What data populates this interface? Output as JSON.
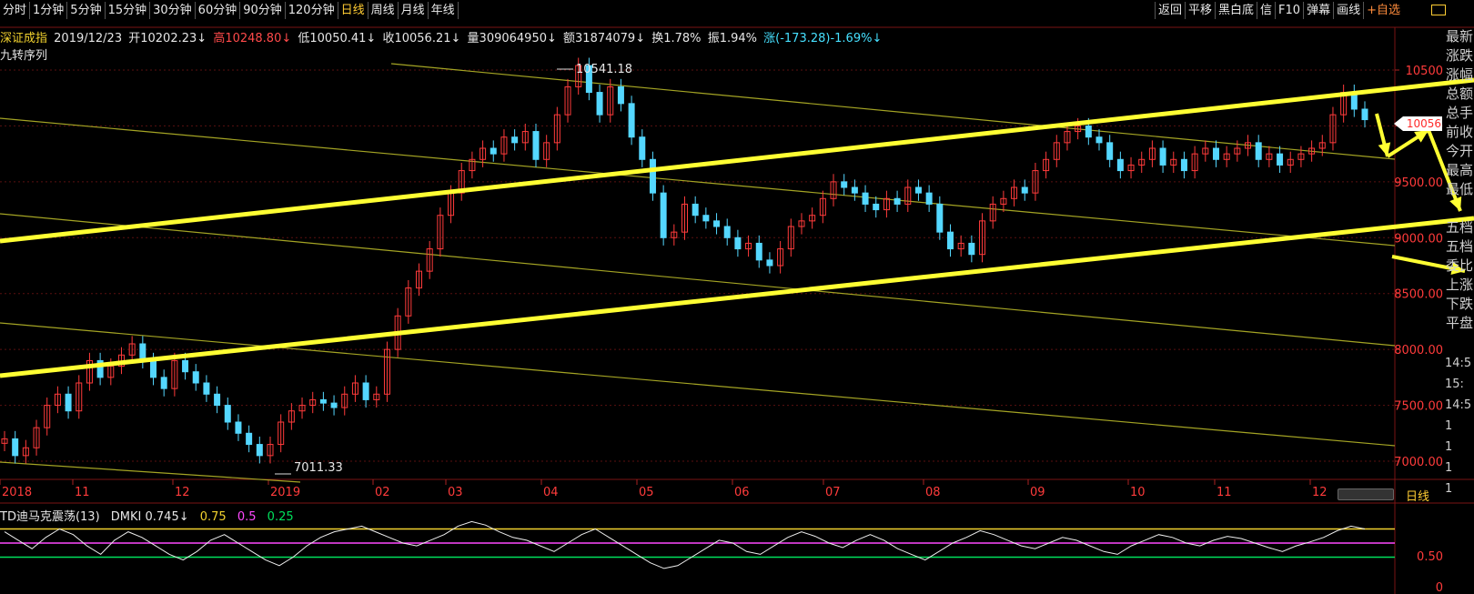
{
  "toolbar": {
    "periods": [
      {
        "label": "分时",
        "active": false
      },
      {
        "label": "1分钟",
        "active": false
      },
      {
        "label": "5分钟",
        "active": false
      },
      {
        "label": "15分钟",
        "active": false
      },
      {
        "label": "30分钟",
        "active": false
      },
      {
        "label": "60分钟",
        "active": false
      },
      {
        "label": "90分钟",
        "active": false
      },
      {
        "label": "120分钟",
        "active": false
      },
      {
        "label": "日线",
        "active": true
      },
      {
        "label": "周线",
        "active": false
      },
      {
        "label": "月线",
        "active": false
      },
      {
        "label": "年线",
        "active": false
      }
    ],
    "actions": [
      {
        "label": "返回"
      },
      {
        "label": "平移"
      },
      {
        "label": "黑白底"
      },
      {
        "label": "信"
      },
      {
        "label": "F10"
      },
      {
        "label": "弹幕"
      },
      {
        "label": "画线"
      },
      {
        "label": "+自选",
        "accent": true
      }
    ]
  },
  "info": {
    "name": "深证成指",
    "date": "2019/12/23",
    "open": "开10202.23↓",
    "high": "高10248.80↓",
    "low": "低10050.41↓",
    "close": "收10056.21↓",
    "volume": "量309064950↓",
    "amount": "额31874079↓",
    "turnover": "换1.78%",
    "amplitude": "振1.94%",
    "change": "涨(-173.28)-1.69%↓"
  },
  "subtitle": "九转序列",
  "indicator": {
    "name": "TD迪马克震荡(13)",
    "dmki": "DMKI 0.745↓",
    "v1": "0.75",
    "v2": "0.5",
    "v3": "0.25"
  },
  "chart_data": {
    "type": "candlestick",
    "y_axis_ticks": [
      "10500",
      "10000",
      "9500.00",
      "9000.00",
      "8500.00",
      "8000.00",
      "7500.00",
      "7000.00"
    ],
    "x_axis_labels": [
      "2018",
      "11",
      "12",
      "2019",
      "02",
      "03",
      "04",
      "05",
      "06",
      "07",
      "08",
      "09",
      "10",
      "11",
      "12"
    ],
    "current_price_label": "10056",
    "peak_label": "10541.18",
    "trough_label": "7011.33",
    "indicator_axis_ticks": [
      "0.50",
      "0"
    ],
    "closes": [
      7200,
      7050,
      7120,
      7300,
      7500,
      7600,
      7450,
      7700,
      7900,
      7750,
      7850,
      7950,
      8050,
      7900,
      7750,
      7650,
      7900,
      7800,
      7700,
      7600,
      7500,
      7350,
      7250,
      7150,
      7050,
      7150,
      7350,
      7450,
      7500,
      7550,
      7520,
      7480,
      7600,
      7700,
      7550,
      7600,
      8000,
      8300,
      8550,
      8700,
      8900,
      9200,
      9400,
      9600,
      9700,
      9800,
      9750,
      9900,
      9850,
      9950,
      9700,
      9850,
      10100,
      10350,
      10540,
      10300,
      10100,
      10350,
      10200,
      9900,
      9700,
      9400,
      9000,
      9050,
      9300,
      9200,
      9150,
      9100,
      9000,
      8900,
      8950,
      8800,
      8750,
      8900,
      9100,
      9150,
      9200,
      9350,
      9500,
      9450,
      9400,
      9300,
      9250,
      9350,
      9300,
      9450,
      9400,
      9300,
      9050,
      8900,
      8950,
      8850,
      9150,
      9300,
      9350,
      9450,
      9400,
      9600,
      9700,
      9850,
      9950,
      10000,
      9900,
      9850,
      9700,
      9600,
      9650,
      9700,
      9800,
      9650,
      9700,
      9600,
      9750,
      9800,
      9700,
      9750,
      9800,
      9850,
      9700,
      9750,
      9650,
      9700,
      9750,
      9800,
      9850,
      10100,
      10300,
      10150,
      10056
    ],
    "indicator_values": [
      0.7,
      0.55,
      0.4,
      0.6,
      0.75,
      0.65,
      0.45,
      0.3,
      0.55,
      0.7,
      0.6,
      0.45,
      0.3,
      0.2,
      0.35,
      0.55,
      0.65,
      0.5,
      0.35,
      0.2,
      0.1,
      0.25,
      0.45,
      0.6,
      0.7,
      0.75,
      0.8,
      0.7,
      0.6,
      0.5,
      0.45,
      0.55,
      0.65,
      0.8,
      0.88,
      0.82,
      0.7,
      0.6,
      0.55,
      0.45,
      0.35,
      0.5,
      0.65,
      0.75,
      0.6,
      0.45,
      0.3,
      0.15,
      0.05,
      0.1,
      0.25,
      0.4,
      0.55,
      0.5,
      0.35,
      0.3,
      0.45,
      0.6,
      0.7,
      0.62,
      0.5,
      0.42,
      0.55,
      0.65,
      0.55,
      0.4,
      0.3,
      0.2,
      0.35,
      0.5,
      0.6,
      0.72,
      0.65,
      0.55,
      0.45,
      0.4,
      0.5,
      0.6,
      0.55,
      0.45,
      0.35,
      0.3,
      0.45,
      0.55,
      0.65,
      0.6,
      0.5,
      0.45,
      0.55,
      0.62,
      0.58,
      0.5,
      0.42,
      0.35,
      0.45,
      0.52,
      0.6,
      0.72,
      0.8,
      0.75
    ],
    "indicator_levels": [
      0.75,
      0.5,
      0.25
    ]
  },
  "panel": {
    "labels": [
      "最新",
      "涨跌",
      "涨幅",
      "总额",
      "总手",
      "前收",
      "今开",
      "最高",
      "最低",
      "",
      "五档",
      "五档",
      "委比",
      "上涨",
      "下跌",
      "平盘"
    ],
    "times": [
      "14:5",
      "15:",
      "14:5",
      "1",
      "1",
      "1",
      "1"
    ]
  },
  "day_badge": "日线",
  "colors": {
    "bg": "#000000",
    "up": "#ff3b3b",
    "down": "#54d7ff",
    "trend": "#ffff33",
    "channel": "#a4a424",
    "grid": "#5a1010"
  }
}
